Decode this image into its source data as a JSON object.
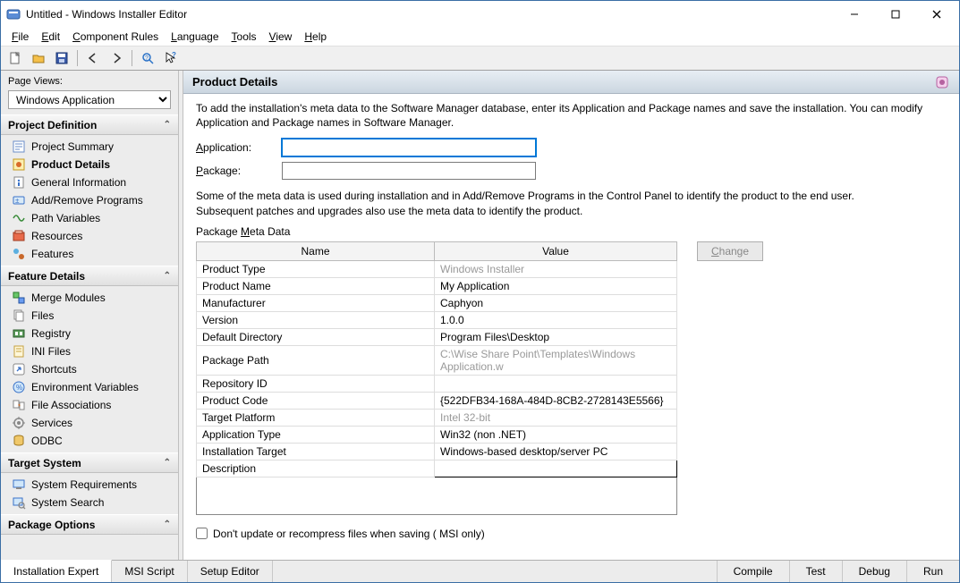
{
  "window": {
    "title": "Untitled - Windows Installer Editor"
  },
  "menu": {
    "file": "File",
    "edit": "Edit",
    "component_rules": "Component Rules",
    "language": "Language",
    "tools": "Tools",
    "view": "View",
    "help": "Help"
  },
  "sidebar": {
    "page_views_label": "Page Views:",
    "view_select": "Windows Application",
    "sections": {
      "project_definition": {
        "title": "Project Definition",
        "items": [
          "Project Summary",
          "Product Details",
          "General Information",
          "Add/Remove Programs",
          "Path Variables",
          "Resources",
          "Features"
        ]
      },
      "feature_details": {
        "title": "Feature Details",
        "items": [
          "Merge Modules",
          "Files",
          "Registry",
          "INI Files",
          "Shortcuts",
          "Environment Variables",
          "File Associations",
          "Services",
          "ODBC"
        ]
      },
      "target_system": {
        "title": "Target System",
        "items": [
          "System Requirements",
          "System Search"
        ]
      },
      "package_options": {
        "title": "Package Options"
      }
    }
  },
  "page": {
    "title": "Product Details",
    "intro": "To add the installation's meta data to the Software Manager database, enter its Application and Package names and save the installation. You can modify Application and Package names in Software Manager.",
    "application_label": "Application:",
    "application_value": "",
    "package_label": "Package:",
    "package_value": "",
    "usage_note": "Some of the meta data is used during installation and in Add/Remove Programs in the Control Panel to identify the product to the end user. Subsequent patches and upgrades also use the meta data to identify the product.",
    "group_label": "Package Meta Data",
    "columns": {
      "name": "Name",
      "value": "Value"
    },
    "rows": [
      {
        "name": "Product Type",
        "value": "Windows Installer",
        "disabled": true
      },
      {
        "name": "Product Name",
        "value": "My Application"
      },
      {
        "name": "Manufacturer",
        "value": "Caphyon"
      },
      {
        "name": "Version",
        "value": "1.0.0"
      },
      {
        "name": "Default Directory",
        "value": "Program Files\\Desktop"
      },
      {
        "name": "Package Path",
        "value": "C:\\Wise Share Point\\Templates\\Windows Application.w",
        "disabled": true
      },
      {
        "name": "Repository ID",
        "value": ""
      },
      {
        "name": "Product Code",
        "value": "{522DFB34-168A-484D-8CB2-2728143E5566}"
      },
      {
        "name": "Target Platform",
        "value": "Intel 32-bit",
        "disabled": true
      },
      {
        "name": "Application Type",
        "value": "Win32 (non .NET)"
      },
      {
        "name": "Installation Target",
        "value": "Windows-based desktop/server PC"
      },
      {
        "name": "Description",
        "value": "",
        "selected": true
      }
    ],
    "change_btn": "Change",
    "checkbox_label": "Don't update or recompress files when saving ( MSI only)"
  },
  "bottom_tabs": {
    "left": [
      "Installation Expert",
      "MSI Script",
      "Setup Editor"
    ],
    "right": [
      "Compile",
      "Test",
      "Debug",
      "Run"
    ]
  }
}
